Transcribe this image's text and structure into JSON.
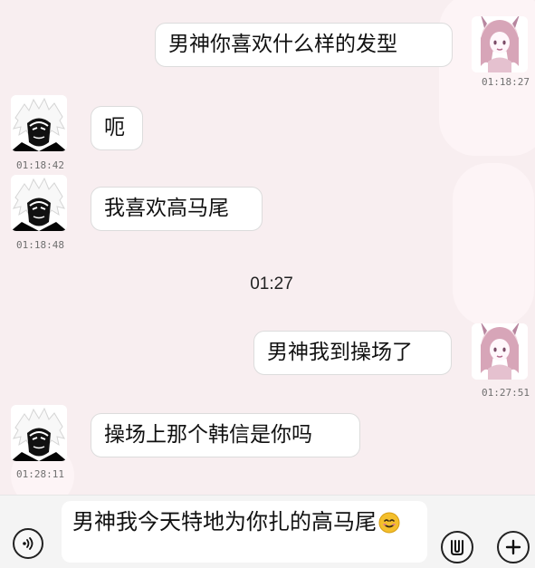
{
  "messages": [
    {
      "side": "right",
      "text": "男神你喜欢什么样的发型",
      "time": "01:18:27"
    },
    {
      "side": "left",
      "text": "呃",
      "time": "01:18:42"
    },
    {
      "side": "left",
      "text": "我喜欢高马尾",
      "time": "01:18:48"
    },
    {
      "side": "right",
      "text": "男神我到操场了",
      "time": "01:27:51"
    },
    {
      "side": "left",
      "text": "操场上那个韩信是你吗",
      "time": "01:28:11"
    }
  ],
  "center_time": "01:27",
  "composer": {
    "text": "男神我今天特地为你扎的高马尾",
    "emoji": "smiling-face-emoji",
    "voice_icon": "voice-icon",
    "emoji_icon": "emoji-icon",
    "plus_icon": "plus-icon"
  }
}
